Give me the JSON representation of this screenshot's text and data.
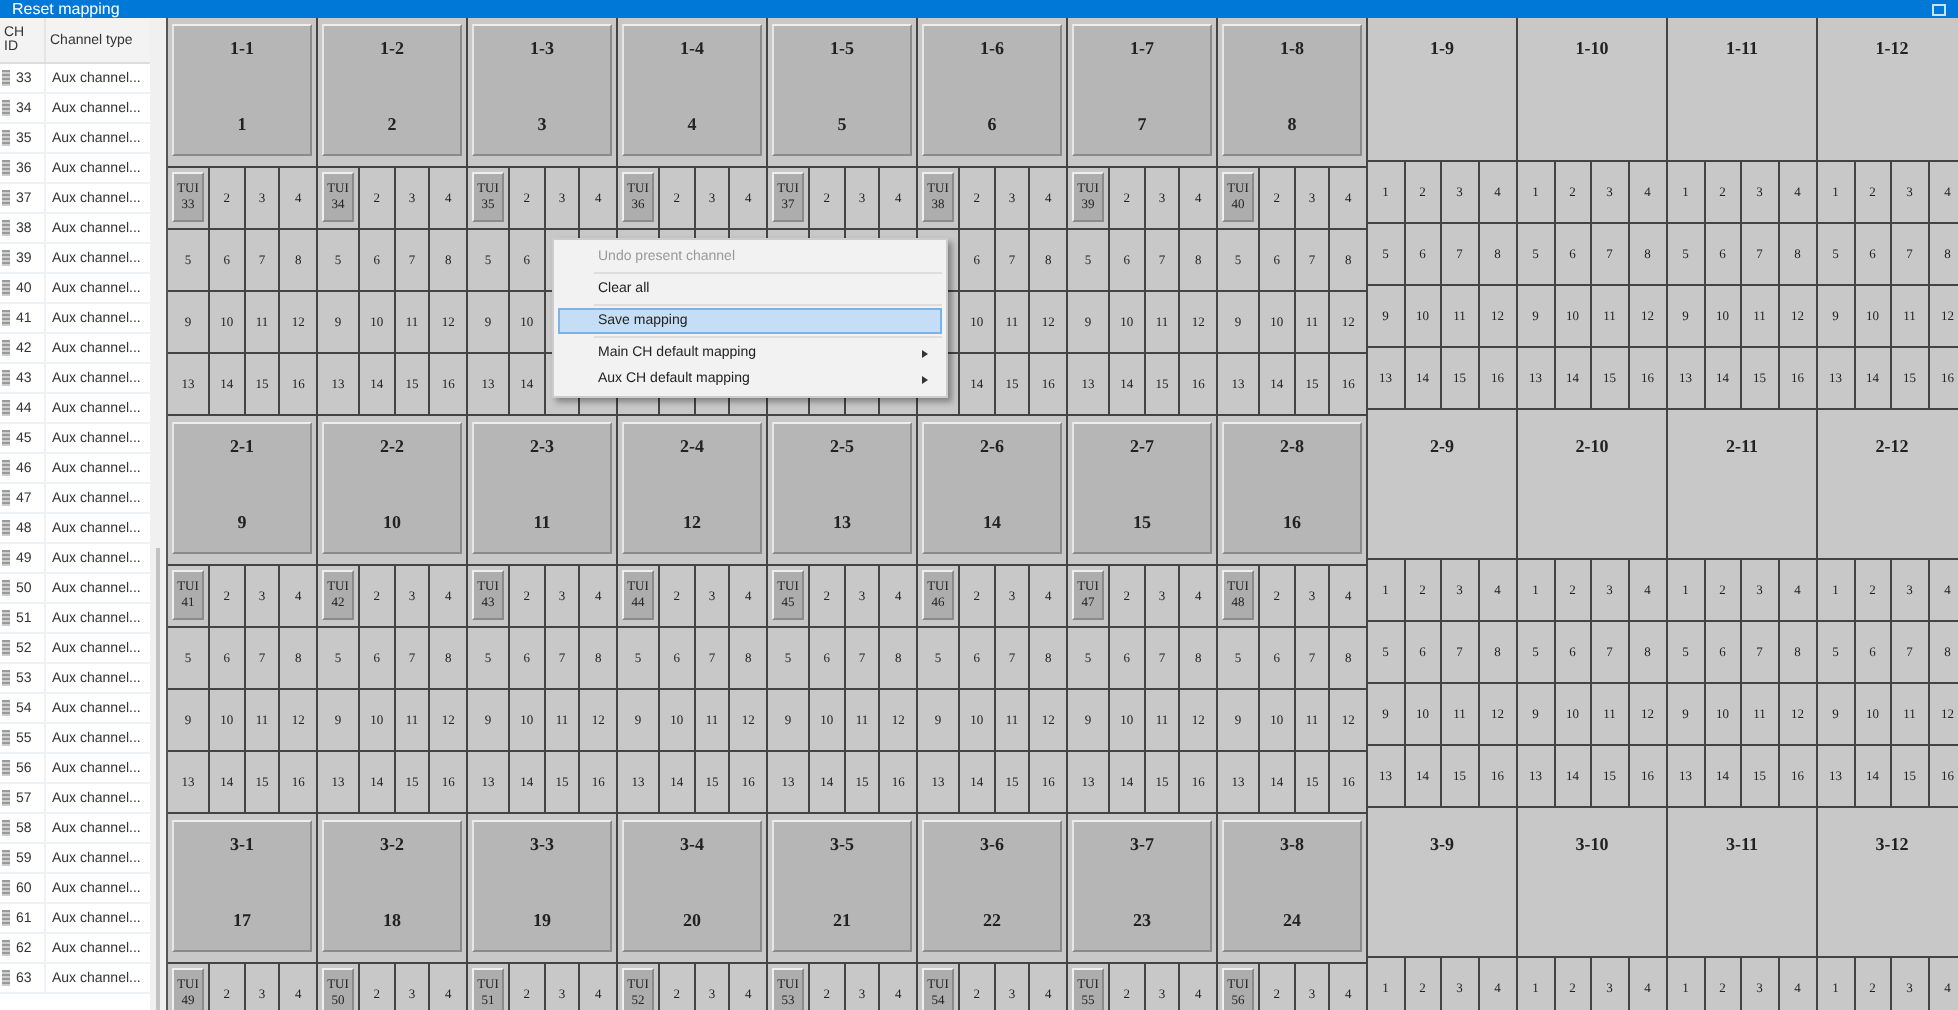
{
  "window": {
    "title": "Reset mapping"
  },
  "channel_table": {
    "columns": [
      "CH ID",
      "Channel type"
    ],
    "rows": [
      {
        "id": "33",
        "type": "Aux channel..."
      },
      {
        "id": "34",
        "type": "Aux channel..."
      },
      {
        "id": "35",
        "type": "Aux channel..."
      },
      {
        "id": "36",
        "type": "Aux channel..."
      },
      {
        "id": "37",
        "type": "Aux channel..."
      },
      {
        "id": "38",
        "type": "Aux channel..."
      },
      {
        "id": "39",
        "type": "Aux channel..."
      },
      {
        "id": "40",
        "type": "Aux channel..."
      },
      {
        "id": "41",
        "type": "Aux channel..."
      },
      {
        "id": "42",
        "type": "Aux channel..."
      },
      {
        "id": "43",
        "type": "Aux channel..."
      },
      {
        "id": "44",
        "type": "Aux channel..."
      },
      {
        "id": "45",
        "type": "Aux channel..."
      },
      {
        "id": "46",
        "type": "Aux channel..."
      },
      {
        "id": "47",
        "type": "Aux channel..."
      },
      {
        "id": "48",
        "type": "Aux channel..."
      },
      {
        "id": "49",
        "type": "Aux channel..."
      },
      {
        "id": "50",
        "type": "Aux channel..."
      },
      {
        "id": "51",
        "type": "Aux channel..."
      },
      {
        "id": "52",
        "type": "Aux channel..."
      },
      {
        "id": "53",
        "type": "Aux channel..."
      },
      {
        "id": "54",
        "type": "Aux channel..."
      },
      {
        "id": "55",
        "type": "Aux channel..."
      },
      {
        "id": "56",
        "type": "Aux channel..."
      },
      {
        "id": "57",
        "type": "Aux channel..."
      },
      {
        "id": "58",
        "type": "Aux channel..."
      },
      {
        "id": "59",
        "type": "Aux channel..."
      },
      {
        "id": "60",
        "type": "Aux channel..."
      },
      {
        "id": "61",
        "type": "Aux channel..."
      },
      {
        "id": "62",
        "type": "Aux channel..."
      },
      {
        "id": "63",
        "type": "Aux channel..."
      }
    ]
  },
  "groups": [
    {
      "tiles": [
        {
          "label": "1-1",
          "number": "1",
          "assigned": true,
          "cells": [
            "TUI 33",
            "2",
            "3",
            "4",
            "5",
            "6",
            "7",
            "8",
            "9",
            "10",
            "11",
            "12",
            "13",
            "14",
            "15",
            "16"
          ]
        },
        {
          "label": "1-2",
          "number": "2",
          "assigned": true,
          "cells": [
            "TUI 34",
            "2",
            "3",
            "4",
            "5",
            "6",
            "7",
            "8",
            "9",
            "10",
            "11",
            "12",
            "13",
            "14",
            "15",
            "16"
          ]
        },
        {
          "label": "1-3",
          "number": "3",
          "assigned": true,
          "cells": [
            "TUI 35",
            "2",
            "3",
            "4",
            "5",
            "6",
            null,
            null,
            "9",
            "10",
            null,
            null,
            "13",
            "14",
            null,
            null
          ]
        },
        {
          "label": "1-4",
          "number": "4",
          "assigned": true,
          "cells": [
            "TUI 36",
            "2",
            "3",
            "4",
            null,
            null,
            null,
            null,
            null,
            null,
            null,
            null,
            null,
            null,
            null,
            null
          ]
        },
        {
          "label": "1-5",
          "number": "5",
          "assigned": true,
          "cells": [
            "TUI 37",
            "2",
            "3",
            "4",
            null,
            null,
            null,
            null,
            null,
            null,
            null,
            null,
            null,
            null,
            null,
            null
          ]
        },
        {
          "label": "1-6",
          "number": "6",
          "assigned": true,
          "cells": [
            "TUI 38",
            "2",
            "3",
            "4",
            null,
            "6",
            "7",
            "8",
            null,
            "10",
            "11",
            "12",
            null,
            "14",
            "15",
            "16"
          ]
        },
        {
          "label": "1-7",
          "number": "7",
          "assigned": true,
          "cells": [
            "TUI 39",
            "2",
            "3",
            "4",
            "5",
            "6",
            "7",
            "8",
            "9",
            "10",
            "11",
            "12",
            "13",
            "14",
            "15",
            "16"
          ]
        },
        {
          "label": "1-8",
          "number": "8",
          "assigned": true,
          "cells": [
            "TUI 40",
            "2",
            "3",
            "4",
            "5",
            "6",
            "7",
            "8",
            "9",
            "10",
            "11",
            "12",
            "13",
            "14",
            "15",
            "16"
          ]
        },
        {
          "label": "1-9",
          "assigned": false,
          "cells": [
            "1",
            "2",
            "3",
            "4",
            "5",
            "6",
            "7",
            "8",
            "9",
            "10",
            "11",
            "12",
            "13",
            "14",
            "15",
            "16"
          ]
        },
        {
          "label": "1-10",
          "assigned": false,
          "cells": [
            "1",
            "2",
            "3",
            "4",
            "5",
            "6",
            "7",
            "8",
            "9",
            "10",
            "11",
            "12",
            "13",
            "14",
            "15",
            "16"
          ]
        },
        {
          "label": "1-11",
          "assigned": false,
          "cells": [
            "1",
            "2",
            "3",
            "4",
            "5",
            "6",
            "7",
            "8",
            "9",
            "10",
            "11",
            "12",
            "13",
            "14",
            "15",
            "16"
          ]
        },
        {
          "label": "1-12",
          "assigned": false,
          "cells": [
            "1",
            "2",
            "3",
            "4",
            "5",
            "6",
            "7",
            "8",
            "9",
            "10",
            "11",
            "12",
            "13",
            "14",
            "15",
            "16"
          ]
        }
      ]
    },
    {
      "tiles": [
        {
          "label": "2-1",
          "number": "9",
          "assigned": true,
          "cells": [
            "TUI 41",
            "2",
            "3",
            "4",
            "5",
            "6",
            "7",
            "8",
            "9",
            "10",
            "11",
            "12",
            "13",
            "14",
            "15",
            "16"
          ]
        },
        {
          "label": "2-2",
          "number": "10",
          "assigned": true,
          "cells": [
            "TUI 42",
            "2",
            "3",
            "4",
            "5",
            "6",
            "7",
            "8",
            "9",
            "10",
            "11",
            "12",
            "13",
            "14",
            "15",
            "16"
          ]
        },
        {
          "label": "2-3",
          "number": "11",
          "assigned": true,
          "cells": [
            "TUI 43",
            "2",
            "3",
            "4",
            "5",
            "6",
            "7",
            "8",
            "9",
            "10",
            "11",
            "12",
            "13",
            "14",
            "15",
            "16"
          ]
        },
        {
          "label": "2-4",
          "number": "12",
          "assigned": true,
          "cells": [
            "TUI 44",
            "2",
            "3",
            "4",
            "5",
            "6",
            "7",
            "8",
            "9",
            "10",
            "11",
            "12",
            "13",
            "14",
            "15",
            "16"
          ]
        },
        {
          "label": "2-5",
          "number": "13",
          "assigned": true,
          "cells": [
            "TUI 45",
            "2",
            "3",
            "4",
            "5",
            "6",
            "7",
            "8",
            "9",
            "10",
            "11",
            "12",
            "13",
            "14",
            "15",
            "16"
          ]
        },
        {
          "label": "2-6",
          "number": "14",
          "assigned": true,
          "cells": [
            "TUI 46",
            "2",
            "3",
            "4",
            "5",
            "6",
            "7",
            "8",
            "9",
            "10",
            "11",
            "12",
            "13",
            "14",
            "15",
            "16"
          ]
        },
        {
          "label": "2-7",
          "number": "15",
          "assigned": true,
          "cells": [
            "TUI 47",
            "2",
            "3",
            "4",
            "5",
            "6",
            "7",
            "8",
            "9",
            "10",
            "11",
            "12",
            "13",
            "14",
            "15",
            "16"
          ]
        },
        {
          "label": "2-8",
          "number": "16",
          "assigned": true,
          "cells": [
            "TUI 48",
            "2",
            "3",
            "4",
            "5",
            "6",
            "7",
            "8",
            "9",
            "10",
            "11",
            "12",
            "13",
            "14",
            "15",
            "16"
          ]
        },
        {
          "label": "2-9",
          "assigned": false,
          "cells": [
            "1",
            "2",
            "3",
            "4",
            "5",
            "6",
            "7",
            "8",
            "9",
            "10",
            "11",
            "12",
            "13",
            "14",
            "15",
            "16"
          ]
        },
        {
          "label": "2-10",
          "assigned": false,
          "cells": [
            "1",
            "2",
            "3",
            "4",
            "5",
            "6",
            "7",
            "8",
            "9",
            "10",
            "11",
            "12",
            "13",
            "14",
            "15",
            "16"
          ]
        },
        {
          "label": "2-11",
          "assigned": false,
          "cells": [
            "1",
            "2",
            "3",
            "4",
            "5",
            "6",
            "7",
            "8",
            "9",
            "10",
            "11",
            "12",
            "13",
            "14",
            "15",
            "16"
          ]
        },
        {
          "label": "2-12",
          "assigned": false,
          "cells": [
            "1",
            "2",
            "3",
            "4",
            "5",
            "6",
            "7",
            "8",
            "9",
            "10",
            "11",
            "12",
            "13",
            "14",
            "15",
            "16"
          ]
        }
      ]
    },
    {
      "tiles": [
        {
          "label": "3-1",
          "number": "17",
          "assigned": true,
          "cells": [
            "TUI 49",
            "2",
            "3",
            "4"
          ]
        },
        {
          "label": "3-2",
          "number": "18",
          "assigned": true,
          "cells": [
            "TUI 50",
            "2",
            "3",
            "4"
          ]
        },
        {
          "label": "3-3",
          "number": "19",
          "assigned": true,
          "cells": [
            "TUI 51",
            "2",
            "3",
            "4"
          ]
        },
        {
          "label": "3-4",
          "number": "20",
          "assigned": true,
          "cells": [
            "TUI 52",
            "2",
            "3",
            "4"
          ]
        },
        {
          "label": "3-5",
          "number": "21",
          "assigned": true,
          "cells": [
            "TUI 53",
            "2",
            "3",
            "4"
          ]
        },
        {
          "label": "3-6",
          "number": "22",
          "assigned": true,
          "cells": [
            "TUI 54",
            "2",
            "3",
            "4"
          ]
        },
        {
          "label": "3-7",
          "number": "23",
          "assigned": true,
          "cells": [
            "TUI 55",
            "2",
            "3",
            "4"
          ]
        },
        {
          "label": "3-8",
          "number": "24",
          "assigned": true,
          "cells": [
            "TUI 56",
            "2",
            "3",
            "4"
          ]
        },
        {
          "label": "3-9",
          "assigned": false,
          "cells": [
            "1",
            "2",
            "3",
            "4"
          ]
        },
        {
          "label": "3-10",
          "assigned": false,
          "cells": [
            "1",
            "2",
            "3",
            "4"
          ]
        },
        {
          "label": "3-11",
          "assigned": false,
          "cells": [
            "1",
            "2",
            "3",
            "4"
          ]
        },
        {
          "label": "3-12",
          "assigned": false,
          "cells": [
            "1",
            "2",
            "3",
            "4"
          ]
        }
      ]
    }
  ],
  "context_menu": {
    "items": [
      {
        "label": "Undo present channel",
        "disabled": true,
        "selected": false,
        "submenu": false
      },
      {
        "label": "Clear all",
        "disabled": false,
        "selected": false,
        "submenu": false
      },
      {
        "label": "Save mapping",
        "disabled": false,
        "selected": true,
        "submenu": false
      },
      {
        "label": "Main CH default mapping",
        "disabled": false,
        "selected": false,
        "submenu": true
      },
      {
        "label": "Aux CH default mapping",
        "disabled": false,
        "selected": false,
        "submenu": true
      }
    ]
  }
}
